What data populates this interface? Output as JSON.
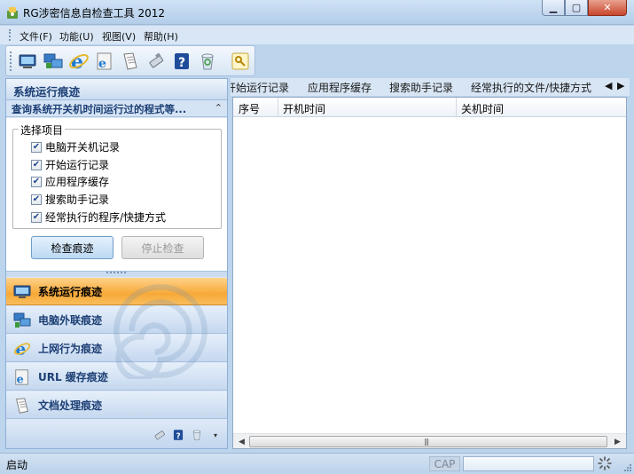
{
  "window": {
    "title": "RG涉密信息自检查工具 2012",
    "minimize_icon": "minimize-icon",
    "maximize_icon": "maximize-icon",
    "close_icon": "close-icon"
  },
  "menu": [
    "文件(F)",
    "功能(U)",
    "视图(V)",
    "帮助(H)"
  ],
  "toolbar": {
    "icons": [
      "computer-icon",
      "network-icon",
      "ie-icon",
      "url-cache-icon",
      "document-icon",
      "usb-drive-icon",
      "help-icon",
      "recycle-bin-icon",
      "key-icon"
    ]
  },
  "left_panel": {
    "header": "系统运行痕迹",
    "subheader": "查询系统开关机时间运行过的程式等...",
    "group_title": "选择项目",
    "checkboxes": [
      {
        "label": "电脑开关机记录",
        "checked": true
      },
      {
        "label": "开始运行记录",
        "checked": true
      },
      {
        "label": "应用程序缓存",
        "checked": true
      },
      {
        "label": "搜索助手记录",
        "checked": true
      },
      {
        "label": "经常执行的程序/快捷方式",
        "checked": true
      }
    ],
    "check_button": "检查痕迹",
    "stop_button": "停止检查",
    "nav": [
      {
        "label": "系统运行痕迹",
        "icon": "monitor-icon",
        "active": true
      },
      {
        "label": "电脑外联痕迹",
        "icon": "network-icon",
        "active": false
      },
      {
        "label": "上网行为痕迹",
        "icon": "ie-icon",
        "active": false
      },
      {
        "label": "URL 缓存痕迹",
        "icon": "url-cache-icon",
        "active": false
      },
      {
        "label": "文档处理痕迹",
        "icon": "document-icon",
        "active": false
      }
    ],
    "footer_icons": [
      "usb-drive-icon",
      "help-icon",
      "recycle-bin-icon",
      "chevron-down-icon"
    ]
  },
  "tabs": [
    "开始运行记录",
    "应用程序缓存",
    "搜索助手记录",
    "经常执行的文件/快捷方式"
  ],
  "table": {
    "columns": [
      "序号",
      "开机时间",
      "关机时间"
    ],
    "rows": []
  },
  "status": {
    "text": "启动",
    "cap": "CAP"
  },
  "colors": {
    "accent": "#f7a938",
    "panel_header": "#1d3f75",
    "background": "#bcd4ec"
  }
}
